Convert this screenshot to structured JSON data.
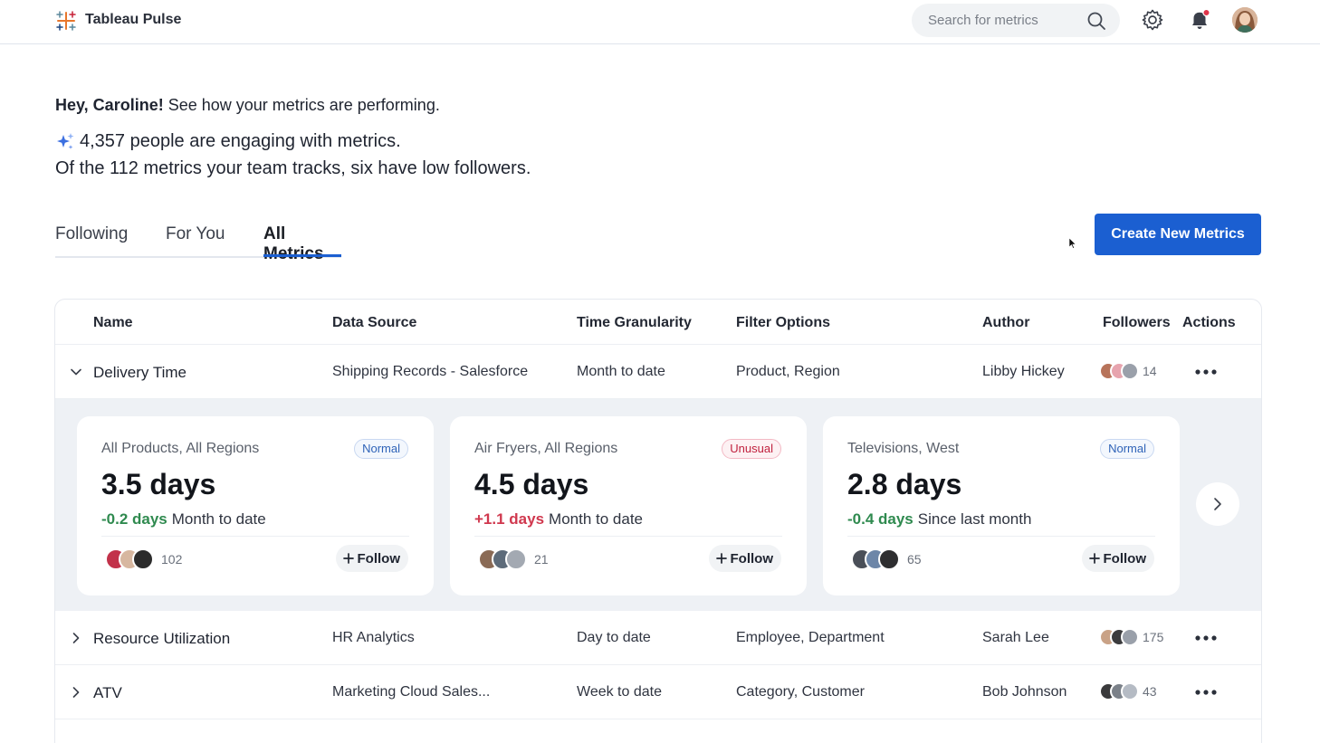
{
  "app": {
    "title": "Tableau Pulse"
  },
  "search": {
    "placeholder": "Search for metrics"
  },
  "header": {
    "greeting_name": "Hey, Caroline!",
    "greeting_rest": " See how your metrics are performing.",
    "insight_line1": "4,357 people are engaging with metrics.",
    "insight_line2": "Of the 112 metrics your team tracks, six have low followers."
  },
  "tabs": [
    {
      "label": "Following",
      "active": false
    },
    {
      "label": "For You",
      "active": false
    },
    {
      "label": "All Metrics",
      "active": true
    }
  ],
  "create_button": "Create New Metrics",
  "table": {
    "columns": [
      "Name",
      "Data Source",
      "Time Granularity",
      "Filter Options",
      "Author",
      "Followers",
      "Actions"
    ],
    "rows": [
      {
        "name": "Delivery Time",
        "source": "Shipping Records - Salesforce",
        "granularity": "Month to date",
        "filters": "Product, Region",
        "author": "Libby Hickey",
        "followers": "14",
        "expanded": true
      },
      {
        "name": "Resource Utilization",
        "source": "HR Analytics",
        "granularity": "Day to date",
        "filters": "Employee, Department",
        "author": "Sarah Lee",
        "followers": "175",
        "expanded": false
      },
      {
        "name": "ATV",
        "source": "Marketing Cloud Sales...",
        "granularity": "Week to date",
        "filters": "Category, Customer",
        "author": "Bob Johnson",
        "followers": "43",
        "expanded": false
      }
    ]
  },
  "cards": [
    {
      "title": "All Products, All Regions",
      "status": "Normal",
      "value": "3.5 days",
      "delta": "-0.2 days",
      "period": "Month to date",
      "followers": "102",
      "follow_label": "Follow"
    },
    {
      "title": "Air Fryers, All Regions",
      "status": "Unusual",
      "value": "4.5 days",
      "delta": "+1.1 days",
      "period": "Month to date",
      "followers": "21",
      "follow_label": "Follow"
    },
    {
      "title": "Televisions, West",
      "status": "Normal",
      "value": "2.8 days",
      "delta": "-0.4 days",
      "period": "Since last month",
      "followers": "65",
      "follow_label": "Follow"
    }
  ],
  "colors": {
    "accent": "#1b5fd1",
    "positive": "#2f8a4f",
    "negative": "#d0384e",
    "notification": "#e0344a"
  },
  "icons": [
    "tableau-logo-icon",
    "search-icon",
    "gear-icon",
    "bell-icon",
    "sparkle-icon",
    "chevron-down-icon",
    "chevron-right-icon",
    "more-icon",
    "plus-icon"
  ]
}
